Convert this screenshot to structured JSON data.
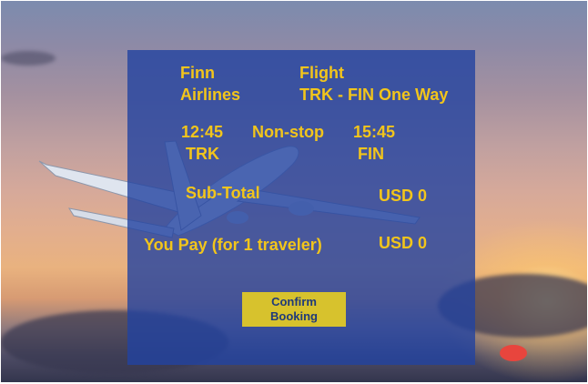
{
  "flight": {
    "airline": "Finn\nAirlines",
    "label": "Flight",
    "route": "TRK - FIN One Way",
    "depart_time": "12:45",
    "depart_code": "TRK",
    "stops": "Non-stop",
    "arrive_time": "15:45",
    "arrive_code": "FIN"
  },
  "pricing": {
    "subtotal_label": "Sub-Total",
    "subtotal_value": "USD 0",
    "pay_label": "You Pay (for 1 traveler)",
    "pay_value": "USD 0"
  },
  "actions": {
    "confirm_label": "Confirm\nBooking"
  },
  "colors": {
    "panel": "#2242a0",
    "text": "#f2c51b",
    "button": "#d7c22d",
    "button_text": "#1f3a7a"
  }
}
